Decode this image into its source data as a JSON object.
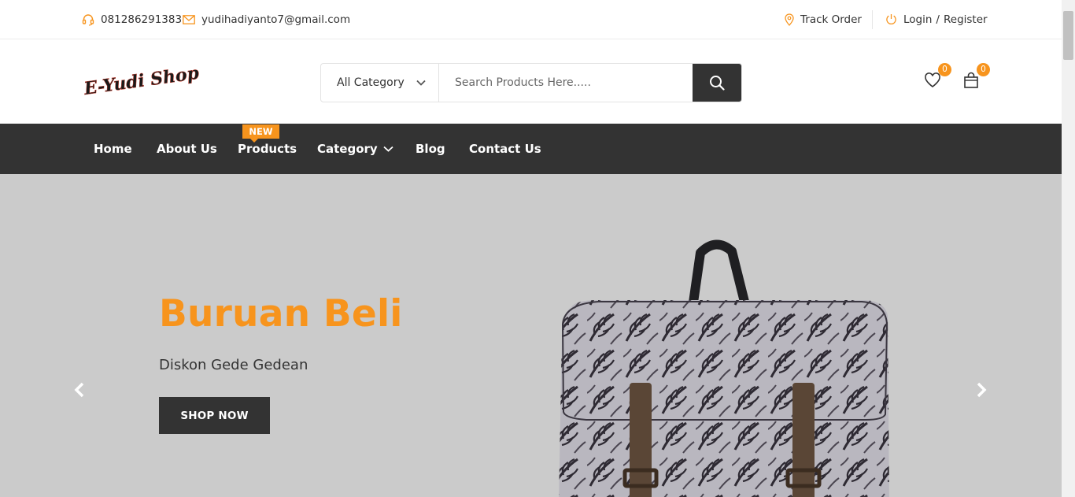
{
  "topbar": {
    "phone": "081286291383",
    "email": "yudihadiyanto7@gmail.com",
    "track_order": "Track Order",
    "login": "Login",
    "slash": "/",
    "register": "Register"
  },
  "header": {
    "logo_text": "E-Yudi Shop",
    "category_selected": "All Category",
    "search_placeholder": "Search Products Here.....",
    "wishlist_count": "0",
    "cart_count": "0"
  },
  "nav": {
    "items": [
      {
        "label": "Home"
      },
      {
        "label": "About Us"
      },
      {
        "label": "Products"
      },
      {
        "label": "Category"
      },
      {
        "label": "Blog"
      },
      {
        "label": "Contact Us"
      }
    ],
    "new_badge": "NEW"
  },
  "hero": {
    "title": "Buruan Beli",
    "subtitle": "Diskon Gede Gedean",
    "button": "SHOP NOW"
  },
  "colors": {
    "accent": "#f7941d",
    "dark": "#333333",
    "hero_bg": "#cbcbcb"
  },
  "icons": {
    "phone": "headset-icon",
    "email": "envelope-icon",
    "track": "map-pin-icon",
    "login": "power-icon",
    "search": "search-icon",
    "wishlist": "heart-icon",
    "cart": "shopping-bag-icon",
    "prev": "chevron-left-icon",
    "next": "chevron-right-icon"
  }
}
